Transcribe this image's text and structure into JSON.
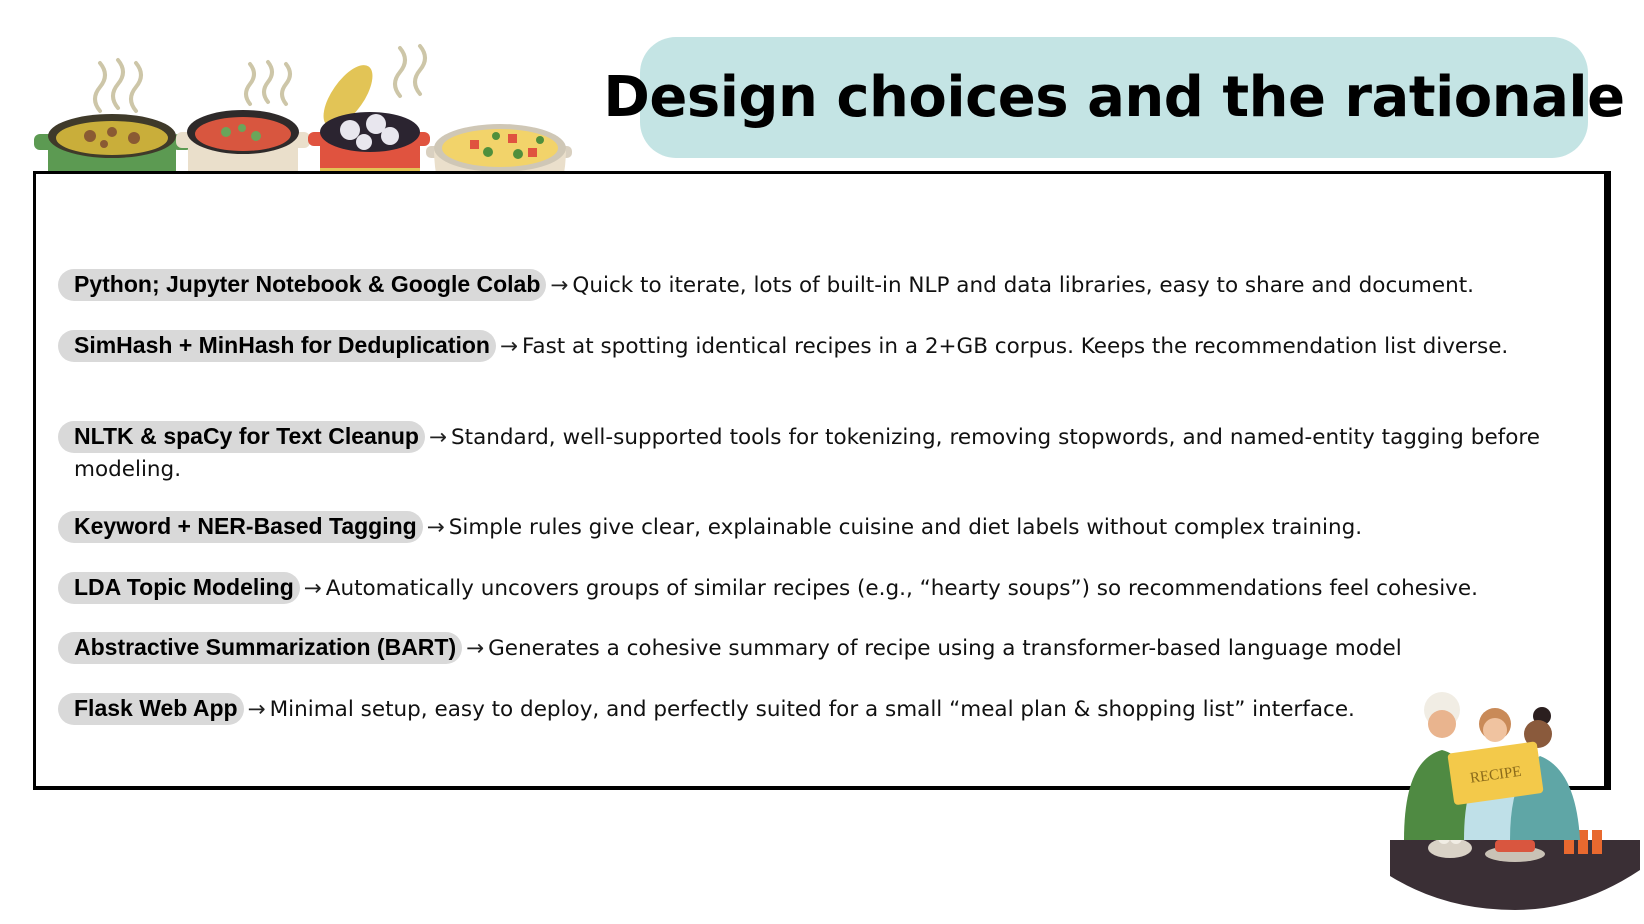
{
  "slide": {
    "title": "Design choices and the rationale",
    "arrow": "→",
    "items": [
      {
        "tag": "Python; Jupyter Notebook & Google Colab",
        "text": "Quick to iterate, lots of built-in NLP and data libraries, easy to share and document."
      },
      {
        "tag": "SimHash + MinHash for Deduplication",
        "text": "Fast at spotting identical recipes in a 2+GB corpus. Keeps the recommendation list diverse."
      },
      {
        "tag": "NLTK & spaCy for Text Cleanup",
        "text": "Standard, well-supported tools for tokenizing, removing stopwords, and named-entity tagging before modeling."
      },
      {
        "tag": "Keyword + NER-Based Tagging",
        "text": "Simple rules give clear, explainable cuisine and diet labels without complex training."
      },
      {
        "tag": "LDA Topic Modeling",
        "text": "Automatically uncovers groups of similar recipes (e.g., “hearty soups”) so recommendations feel cohesive."
      },
      {
        "tag": "Abstractive Summarization (BART)",
        "text": "Generates a cohesive summary of recipe using a transformer-based language model"
      },
      {
        "tag": "Flask Web App",
        "text": "Minimal setup, easy to deploy, and perfectly suited for a small “meal plan & shopping list” interface."
      }
    ],
    "illustration_card_text": "RECIPE",
    "colors": {
      "title_pill": "#c4e4e4",
      "tag_bg": "#d9d9d9",
      "pot_green": "#5c9a52",
      "pot_red": "#e0533f",
      "pot_cream": "#eadfcb",
      "table": "#3a2f35"
    }
  }
}
